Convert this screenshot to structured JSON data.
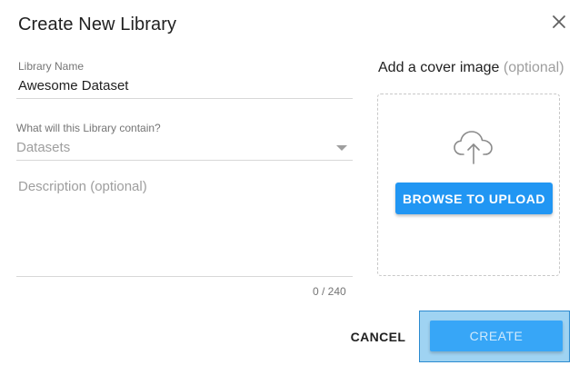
{
  "dialog": {
    "title": "Create New Library",
    "close_icon": "close-icon"
  },
  "form": {
    "library_name": {
      "label": "Library Name",
      "value": "Awesome Dataset"
    },
    "contains": {
      "label": "What will this Library contain?",
      "value": "Datasets"
    },
    "description": {
      "placeholder": "Description (optional)",
      "counter": "0 / 240"
    }
  },
  "cover": {
    "title": "Add a cover image",
    "optional": "(optional)",
    "upload_icon": "cloud-upload-icon",
    "browse_label": "BROWSE TO UPLOAD"
  },
  "actions": {
    "cancel_label": "CANCEL",
    "create_label": "CREATE"
  },
  "colors": {
    "primary": "#2196f3",
    "create_disabled": "#37a6f7",
    "focus_highlight": "#9fd3f2"
  }
}
